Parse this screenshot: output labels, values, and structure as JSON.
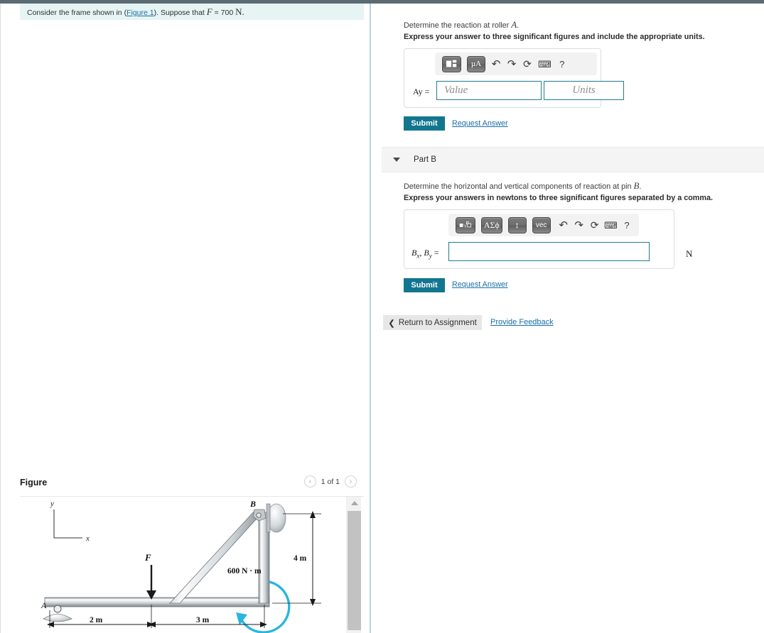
{
  "problem": {
    "text_before_link": "Consider the frame shown in (",
    "figure_link": "Figure 1",
    "text_after_link": "). Suppose that ",
    "force_symbol": "F",
    "force_value": " = 700 ",
    "force_unit": "N."
  },
  "partA": {
    "question": "Determine the reaction at roller ",
    "question_symbol": "A",
    "question_end": ".",
    "instruction": "Express your answer to three significant figures and include the appropriate units.",
    "answer_label": "Ay =",
    "value_placeholder": "Value",
    "units_placeholder": "Units",
    "submit_label": "Submit",
    "request_answer_label": "Request Answer",
    "toolbar": [
      {
        "name": "template-matrix-icon",
        "glyph": "■˛"
      },
      {
        "name": "units-micro-amp-icon",
        "glyph": "µA"
      },
      {
        "name": "undo-icon",
        "glyph": "↶"
      },
      {
        "name": "redo-icon",
        "glyph": "↷"
      },
      {
        "name": "reset-icon",
        "glyph": "⟳"
      },
      {
        "name": "keyboard-icon",
        "glyph": "⌨"
      },
      {
        "name": "help-icon",
        "glyph": "?"
      }
    ]
  },
  "partB": {
    "header_label": "Part B",
    "question": "Determine the horizontal and vertical components of reaction at pin ",
    "question_symbol": "B",
    "question_end": ".",
    "instruction": "Express your answers in newtons to three significant figures separated by a comma.",
    "answer_label": "Bx, By =",
    "input_value": "",
    "unit_suffix": "N",
    "submit_label": "Submit",
    "request_answer_label": "Request Answer",
    "toolbar": [
      {
        "name": "template-radical-icon",
        "glyph": "■√□"
      },
      {
        "name": "greek-symbols-icon",
        "glyph": "ΑΣϕ"
      },
      {
        "name": "arrows-updown-icon",
        "glyph": "↕"
      },
      {
        "name": "vector-icon",
        "glyph": "vec"
      },
      {
        "name": "undo-icon",
        "glyph": "↶"
      },
      {
        "name": "redo-icon",
        "glyph": "↷"
      },
      {
        "name": "reset-icon",
        "glyph": "⟳"
      },
      {
        "name": "keyboard-icon",
        "glyph": "⌨"
      },
      {
        "name": "help-icon",
        "glyph": "?"
      }
    ]
  },
  "footer": {
    "return_label": "Return to Assignment",
    "feedback_label": "Provide Feedback"
  },
  "figure": {
    "title": "Figure",
    "counter": "1 of 1",
    "prev_icon": "‹",
    "next_icon": "›",
    "labels": {
      "axis_y": "y",
      "axis_x": "x",
      "point_a": "A",
      "point_b": "B",
      "force": "F",
      "moment": "600 N · m",
      "dim_vertical": "4 m",
      "dim_left": "2 m",
      "dim_right": "3 m"
    }
  },
  "colors": {
    "accent_teal": "#12768f",
    "link_blue": "#1b6ea8",
    "banner_bg": "#e6f4f3",
    "part_header_bg": "#f4f4f4",
    "moment_arrow": "#29b6e0",
    "top_strip": "#5c6b73"
  }
}
